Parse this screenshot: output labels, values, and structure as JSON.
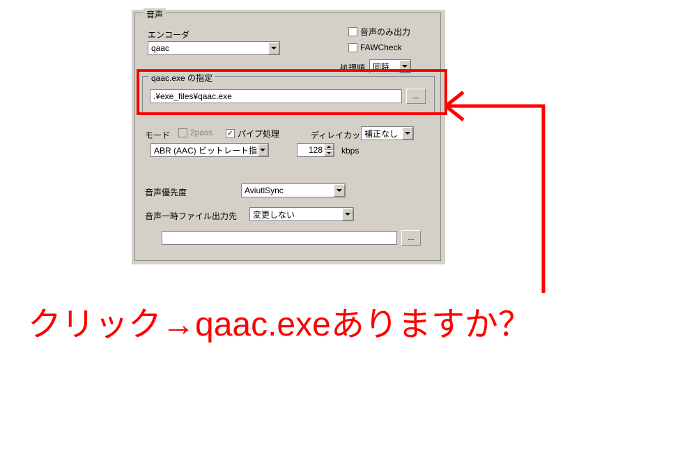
{
  "groupbox": {
    "title": "音声",
    "encoder_label": "エンコーダ",
    "encoder_value": "qaac",
    "audio_only_label": "音声のみ出力",
    "fawcheck_label": "FAWCheck",
    "order_label": "処理順",
    "order_value": "同時",
    "path_group_title": "qaac.exe の指定",
    "path_value": ".¥exe_files¥qaac.exe",
    "browse_label": "...",
    "mode_label": "モード",
    "twopass_label": "2pass",
    "pipe_label": "パイプ処理",
    "delay_label": "ディレイカット",
    "delay_value": "補正なし",
    "mode_value": "ABR (AAC) ビットレート指定",
    "bitrate_value": "128",
    "bitrate_unit": "kbps",
    "priority_label": "音声優先度",
    "priority_value": "AviutlSync",
    "temp_label": "音声一時ファイル出力先",
    "temp_value": "変更しない",
    "temp_path_value": "",
    "temp_browse_label": "..."
  },
  "annotation": {
    "text": "クリック→qaac.exeありますか？"
  }
}
